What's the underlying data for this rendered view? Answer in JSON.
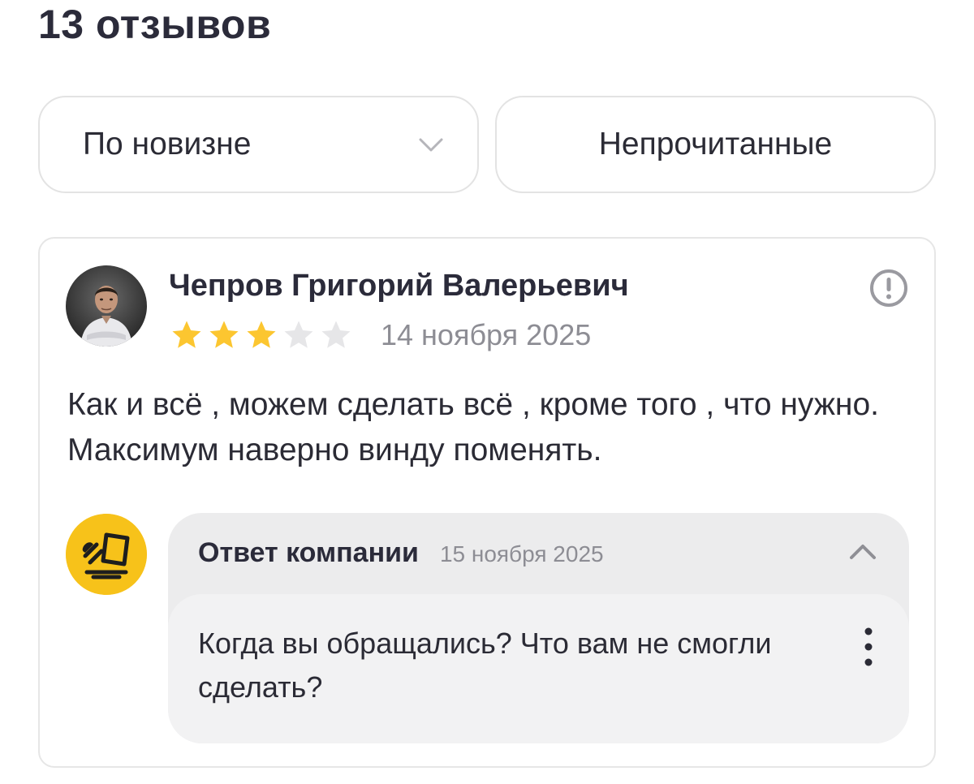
{
  "header": {
    "reviews_count_title": "13 отзывов"
  },
  "filters": {
    "sort_label": "По новизне",
    "unread_label": "Непрочитанные"
  },
  "review": {
    "author": "Чепров Григорий Валерьевич",
    "rating": 3,
    "rating_max": 5,
    "date": "14 ноября 2025",
    "text": "Как и всё , можем сделать всё , кроме того , что нужно. Максимум наверно винду поменять.",
    "icons": {
      "avatar": "user-photo",
      "report": "exclamation-circle-icon"
    }
  },
  "company_reply": {
    "title": "Ответ компании",
    "date": "15 ноября 2025",
    "text": "Когда вы обращались? Что вам не смогли сделать?",
    "icons": {
      "logo": "company-logo",
      "collapse": "chevron-up-icon",
      "menu": "more-vertical-icon"
    }
  },
  "colors": {
    "star_filled": "#fcc630",
    "star_empty": "#e6e6e8",
    "company_logo_bg": "#f7c21a",
    "reply_header_bg": "#ececed",
    "reply_body_bg": "#f2f2f3"
  }
}
